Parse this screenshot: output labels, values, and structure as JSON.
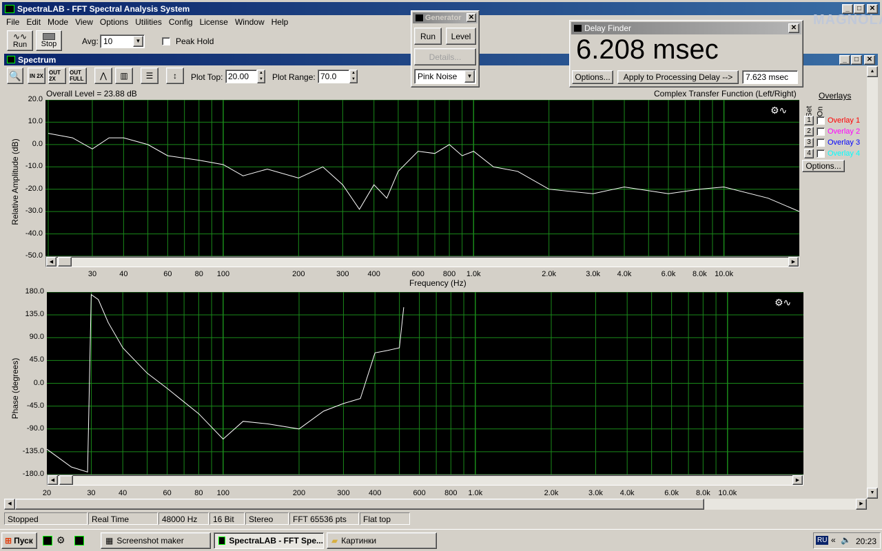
{
  "window": {
    "title": "SpectraLAB - FFT Spectral Analysis System",
    "menu": [
      "File",
      "Edit",
      "Mode",
      "View",
      "Options",
      "Utilities",
      "Config",
      "License",
      "Window",
      "Help"
    ]
  },
  "toolbar": {
    "run": "Run",
    "stop": "Stop",
    "avg_label": "Avg:",
    "avg_value": "10",
    "peak_hold": "Peak Hold"
  },
  "spectrum": {
    "title": "Spectrum",
    "plot_top_label": "Plot Top:",
    "plot_top": "20.00",
    "plot_range_label": "Plot Range:",
    "plot_range": "70.0"
  },
  "amp": {
    "overall": "Overall Level = 23.88 dB",
    "func": "Complex Transfer Function (Left/Right)",
    "ylabel": "Relative Amplitude (dB)",
    "xlabel": "Frequency (Hz)",
    "yticks": [
      "20.0",
      "10.0",
      "0.0",
      "-10.0",
      "-20.0",
      "-30.0",
      "-40.0",
      "-50.0"
    ],
    "xticks": [
      "30",
      "40",
      "60",
      "80",
      "100",
      "200",
      "300",
      "400",
      "600",
      "800",
      "1.0k",
      "2.0k",
      "3.0k",
      "4.0k",
      "6.0k",
      "8.0k",
      "10.0k"
    ]
  },
  "phase": {
    "ylabel": "Phase (degrees)",
    "yticks": [
      "180.0",
      "135.0",
      "90.0",
      "45.0",
      "0.0",
      "-45.0",
      "-90.0",
      "-135.0",
      "-180.0"
    ],
    "xticks": [
      "20",
      "30",
      "40",
      "60",
      "80",
      "100",
      "200",
      "300",
      "400",
      "600",
      "800",
      "1.0k",
      "2.0k",
      "3.0k",
      "4.0k",
      "6.0k",
      "8.0k",
      "10.0k"
    ]
  },
  "overlays": {
    "title": "Overlays",
    "set": "Set",
    "on": "On",
    "options": "Options...",
    "items": [
      {
        "num": "1",
        "label": "Overlay 1",
        "color": "#ff0000"
      },
      {
        "num": "2",
        "label": "Overlay 2",
        "color": "#ff00ff"
      },
      {
        "num": "3",
        "label": "Overlay 3",
        "color": "#0000ff"
      },
      {
        "num": "4",
        "label": "Overlay 4",
        "color": "#00ffff"
      }
    ]
  },
  "generator": {
    "title": "Generator",
    "run": "Run",
    "level": "Level",
    "details": "Details...",
    "signal": "Pink Noise"
  },
  "delay": {
    "title": "Delay Finder",
    "value": "6.208 msec",
    "options": "Options...",
    "apply": "Apply to Processing Delay -->",
    "result": "7.623 msec"
  },
  "logo": "MAGNOLA",
  "status": [
    "Stopped",
    "Real Time",
    "48000 Hz",
    "16 Bit",
    "Stereo",
    "FFT 65536 pts",
    "Flat top"
  ],
  "taskbar": {
    "start": "Пуск",
    "tasks": [
      "Screenshot maker",
      "SpectraLAB - FFT Spe...",
      "Картинки"
    ],
    "lang": "RU",
    "time": "20:23"
  },
  "colors": {
    "plot_bg": "#000000",
    "grid": "#1a8a1a",
    "trace": "#ffffff",
    "title_active": "#0a246a"
  },
  "chart_data": [
    {
      "type": "line",
      "title": "",
      "xlabel": "Frequency (Hz)",
      "ylabel": "Relative Amplitude (dB)",
      "xscale": "log",
      "xlim": [
        20,
        20000
      ],
      "ylim": [
        -50,
        20
      ],
      "series": [
        {
          "x": [
            20,
            25,
            30,
            35,
            40,
            50,
            60,
            80,
            100,
            120,
            150,
            200,
            250,
            300,
            350,
            400,
            450,
            500,
            600,
            700,
            800,
            900,
            1000,
            1200,
            1500,
            2000,
            3000,
            4000,
            6000,
            8000,
            10000,
            15000,
            20000
          ],
          "values": [
            5,
            3,
            -2,
            3,
            3,
            0,
            -5,
            -7,
            -9,
            -14,
            -11,
            -15,
            -10,
            -18,
            -29,
            -18,
            -24,
            -12,
            -3,
            -4,
            0,
            -5,
            -3,
            -10,
            -12,
            -20,
            -22,
            -19,
            -22,
            -20,
            -19,
            -24,
            -30
          ]
        }
      ]
    },
    {
      "type": "line",
      "title": "",
      "xlabel": "Frequency (Hz)",
      "ylabel": "Phase (degrees)",
      "xscale": "log",
      "xlim": [
        20,
        20000
      ],
      "ylim": [
        -180,
        180
      ],
      "series": [
        {
          "x": [
            20,
            25,
            29,
            30,
            32,
            35,
            40,
            50,
            60,
            80,
            100,
            120,
            150,
            200,
            250,
            300,
            350,
            400,
            450,
            500,
            520
          ],
          "values": [
            -130,
            -165,
            -175,
            175,
            165,
            120,
            70,
            20,
            -10,
            -60,
            -110,
            -75,
            -80,
            -90,
            -55,
            -40,
            -30,
            60,
            65,
            70,
            150
          ]
        }
      ]
    }
  ]
}
